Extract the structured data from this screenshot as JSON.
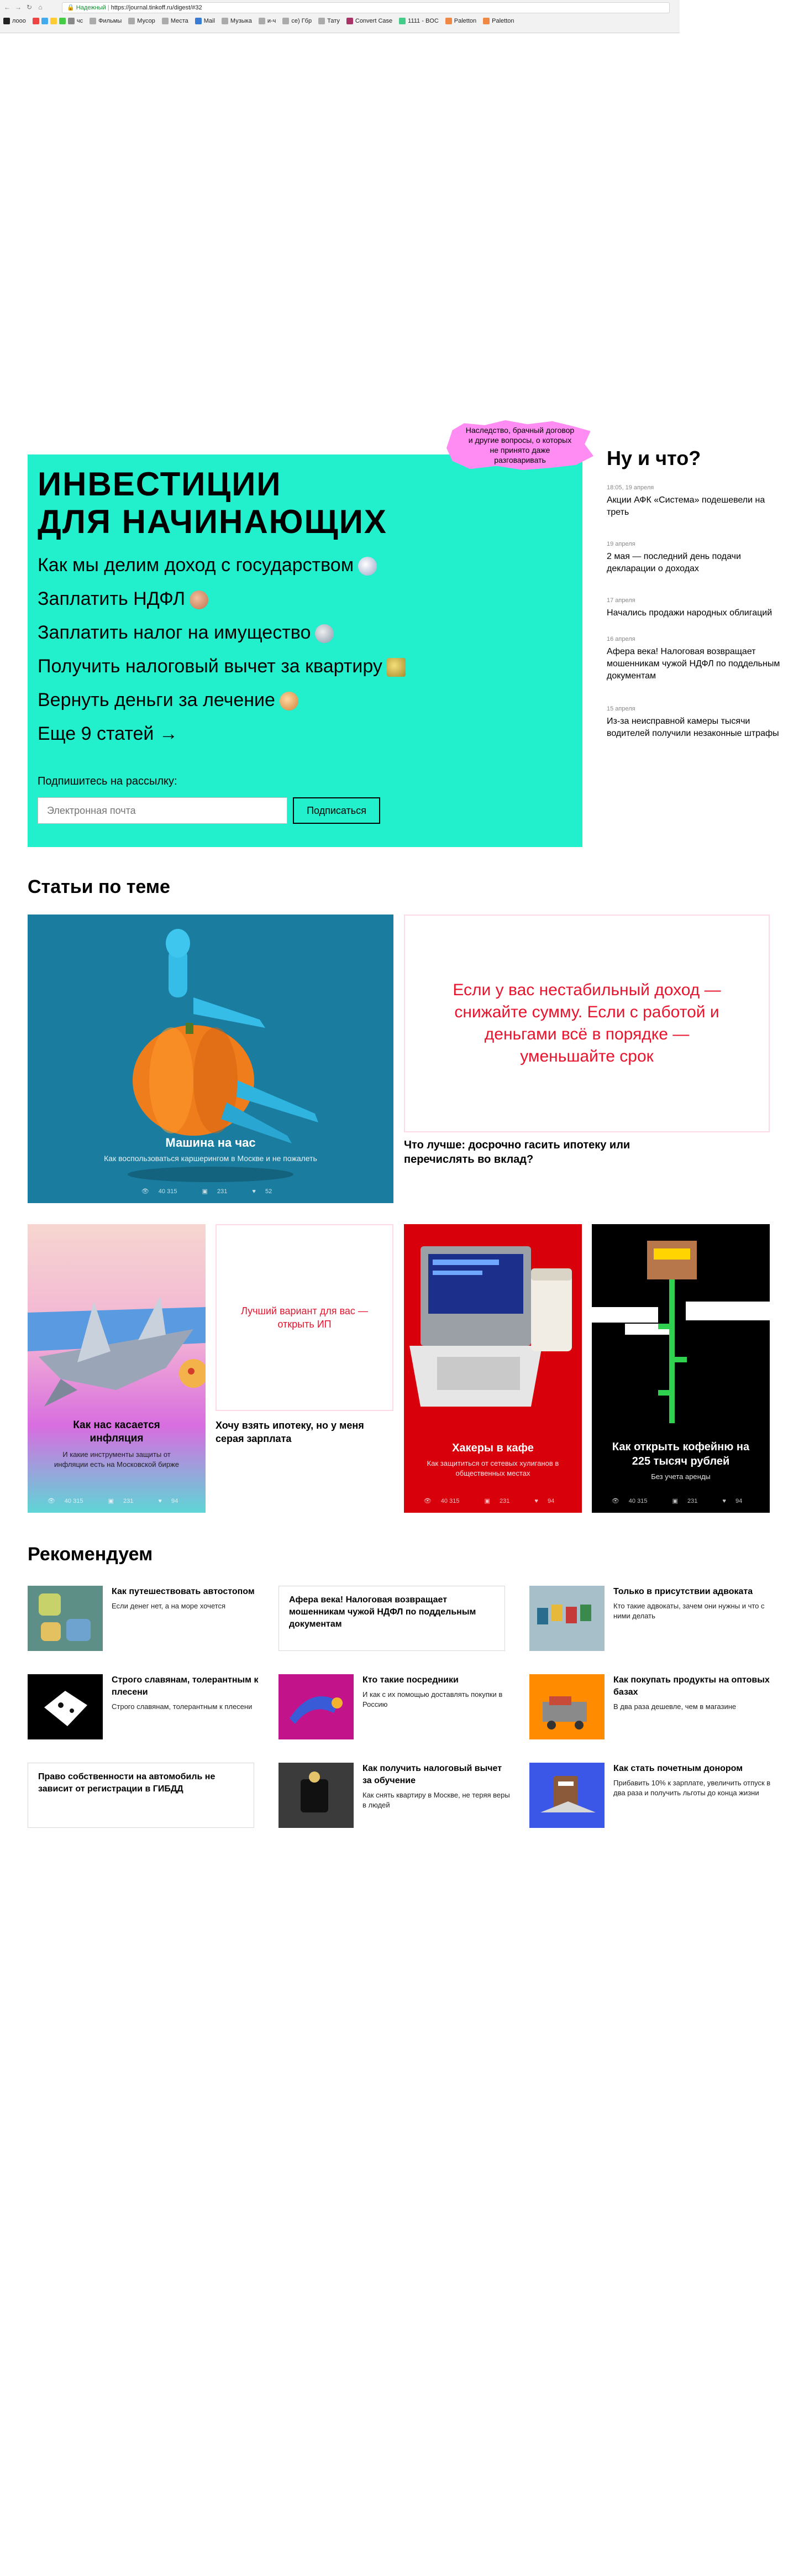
{
  "browser": {
    "secure_label": "Надежный",
    "url": "https://journal.tinkoff.ru/digest/#32",
    "bookmarks": [
      "лооо",
      "чс",
      "Фильмы",
      "Мусор",
      "Места",
      "Mail",
      "Музыка",
      "и-ч",
      "се) Гбр",
      "Тату",
      "Convert Case",
      "1111 - BOC",
      "Paletton",
      "Paletton"
    ]
  },
  "hero": {
    "title": "ИНВЕСТИЦИИ\nДЛЯ НАЧИНАЮЩИХ",
    "items": [
      "Как мы делим доход с государством",
      "Заплатить НДФЛ",
      "Заплатить налог на имущество",
      "Получить налоговый вычет за квартиру",
      "Вернуть деньги за лечение",
      "Еще 9 статей →"
    ],
    "subscribe_label": "Подпишитесь на рассылку:",
    "email_placeholder": "Электронная почта",
    "subscribe_button": "Подписаться",
    "sticker_text": "Наследство, брачный договор и другие вопросы, о которых не принято даже разговаривать"
  },
  "side": {
    "title": "Ну и что?",
    "news": [
      {
        "date": "18:05, 19 апреля",
        "text": "Акции АФК «Система» подешевели на треть"
      },
      {
        "date": "19 апреля",
        "text": "2 мая — последний день подачи декларации о доходах"
      },
      {
        "date": "17 апреля",
        "text": "Начались продажи народных облигаций"
      },
      {
        "date": "16 апреля",
        "text": "Афера века! Налоговая возвращает мошенникам чужой НДФЛ по поддельным документам"
      },
      {
        "date": "15 апреля",
        "text": "Из-за неисправной камеры тысячи водителей получили незаконные штрафы"
      }
    ]
  },
  "related": {
    "heading": "Статьи по теме",
    "card1": {
      "title": "Машина на час",
      "sub": "Как воспользоваться каршерингом в Москве и не пожалеть",
      "views": "40 315",
      "comments": "231",
      "likes": "52"
    },
    "quote1": {
      "text": "Если у вас нестабильный доход — снижайте сумму. Если с работой и деньгами всё в порядке — уменьшайте срок",
      "caption": "Что лучше: досрочно гасить ипотеку или перечислять во вклад?"
    },
    "card2": {
      "title": "Как нас касается инфляция",
      "sub": "И какие инструменты защиты от инфляции есть на Московской бирже",
      "views": "40 315",
      "comments": "231",
      "likes": "94"
    },
    "quote2": {
      "text": "Лучший вариант для вас — открыть ИП",
      "caption": "Хочу взять ипотеку, но у меня серая зарплата"
    },
    "card3": {
      "title": "Хакеры в кафе",
      "sub": "Как защититься от сетевых хулиганов в общественных местах",
      "views": "40 315",
      "comments": "231",
      "likes": "94"
    },
    "card4": {
      "title": "Как открыть кофейню на 225 тысяч рублей",
      "sub": "Без учета аренды",
      "views": "40 315",
      "comments": "231",
      "likes": "94"
    }
  },
  "recommend": {
    "heading": "Рекомендуем",
    "items": [
      {
        "title": "Как путешествовать автостопом",
        "sub": "Если денег нет, а на море хочется"
      },
      {
        "title": "Афера века! Налоговая возвращает мошенникам чужой НДФЛ по поддельным документам",
        "sub": ""
      },
      {
        "title": "Только в присутствии адвоката",
        "sub": "Кто такие адвокаты, зачем они нужны и что с ними делать"
      },
      {
        "title": "Строго славянам, толерантным к плесени",
        "sub": "Строго славянам, толерантным к плесени"
      },
      {
        "title": "Кто такие посредники",
        "sub": "И как с их помощью доставлять покупки в Россию"
      },
      {
        "title": "Как покупать продукты на оптовых базах",
        "sub": "В два раза дешевле, чем в магазине"
      },
      {
        "title": "Право собственности на автомобиль не зависит от регистрации в ГИБДД",
        "sub": ""
      },
      {
        "title": "Как получить налоговый вычет за обучение",
        "sub": "Как снять квартиру в Москве, не теряя веры в людей"
      },
      {
        "title": "Как стать почетным донором",
        "sub": "Прибавить 10% к зарплате, увеличить отпуск в два раза и получить льготы до конца жизни"
      }
    ]
  },
  "colors": {
    "hero_bg": "#22f0cd",
    "sticker": "#ff8cf2",
    "accent_red": "#e8132c"
  }
}
